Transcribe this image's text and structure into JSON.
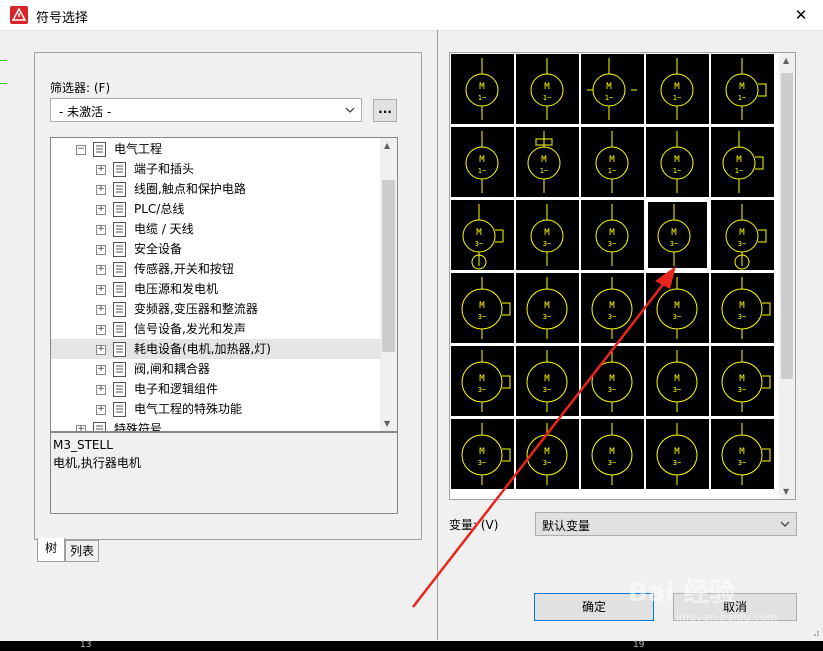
{
  "window": {
    "title": "符号选择",
    "close_glyph": "✕"
  },
  "filter": {
    "label": "筛选器: (F)",
    "selected": "- 未激活 -",
    "more_button": "..."
  },
  "tree": {
    "root": "电气工程",
    "items": [
      "端子和插头",
      "线圈,触点和保护电路",
      "PLC/总线",
      "电缆 / 天线",
      "安全设备",
      "传感器,开关和按钮",
      "电压源和发电机",
      "变频器,变压器和整流器",
      "信号设备,发光和发声",
      "耗电设备(电机,加热器,灯)",
      "阀,闸和耦合器",
      "电子和逻辑组件",
      "电气工程的特殊功能"
    ],
    "next_root": "特殊符号",
    "selected_index": 9
  },
  "description": {
    "name": "M3_STELL",
    "text": "电机,执行器电机"
  },
  "tabs": [
    {
      "label": "树"
    },
    {
      "label": "列表"
    }
  ],
  "variant": {
    "label": "变量: (V)",
    "selected": "默认变量"
  },
  "buttons": {
    "ok": "确定",
    "cancel": "取消"
  },
  "symbols": {
    "rows": 6,
    "cols": 5,
    "selected_row": 2,
    "selected_col": 3
  },
  "colors": {
    "symbol_stroke": "#ffff00",
    "symbol_bg": "#000000",
    "arrow": "#e8251d"
  },
  "watermark": {
    "text": "Bai 经验",
    "url": "jingyan.baidu.com"
  },
  "bottom_ruler": [
    "13",
    "19"
  ]
}
